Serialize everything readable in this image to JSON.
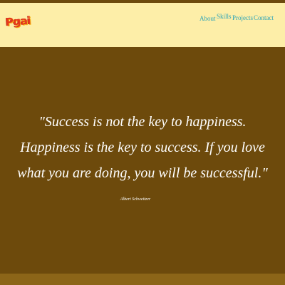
{
  "header": {
    "logo_text": "Pgai",
    "nav": [
      {
        "label": "About"
      },
      {
        "label": "Skills"
      },
      {
        "label": "Projects"
      },
      {
        "label": "Contact"
      }
    ]
  },
  "hero": {
    "quote": "\"Success is not the key to happiness. Happiness is the key to success. If you love what you are doing, you will be successful.\"",
    "author": "Albert Schweitzer"
  },
  "colors": {
    "header_bg": "#fdeea8",
    "main_bg": "#6d4a0c",
    "nav_link": "#2aa3b8",
    "footer_strip": "#8c6518"
  }
}
